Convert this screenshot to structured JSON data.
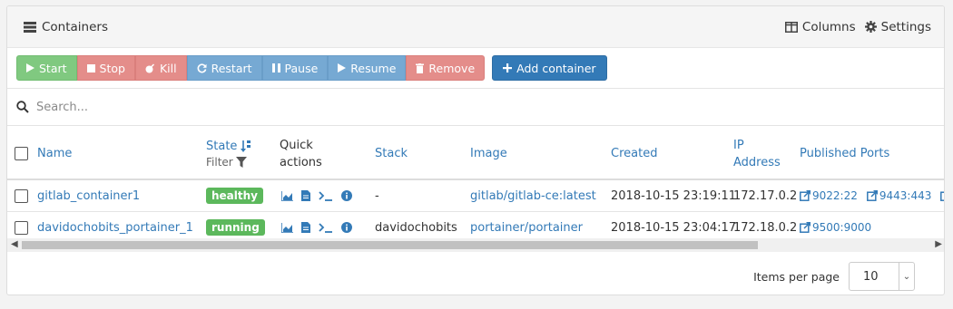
{
  "header": {
    "title": "Containers",
    "columns_label": "Columns",
    "settings_label": "Settings"
  },
  "actions": {
    "start": "Start",
    "stop": "Stop",
    "kill": "Kill",
    "restart": "Restart",
    "pause": "Pause",
    "resume": "Resume",
    "remove": "Remove",
    "add": "Add container"
  },
  "search": {
    "placeholder": "Search..."
  },
  "columns": {
    "name": "Name",
    "state": "State",
    "filter": "Filter",
    "quick_actions_1": "Quick",
    "quick_actions_2": "actions",
    "stack": "Stack",
    "image": "Image",
    "created": "Created",
    "ip_1": "IP",
    "ip_2": "Address",
    "ports": "Published Ports"
  },
  "rows": [
    {
      "name": "gitlab_container1",
      "state": "healthy",
      "stack": "-",
      "image": "gitlab/gitlab-ce:latest",
      "created": "2018-10-15 23:19:11",
      "ip": "172.17.0.2",
      "ports": [
        "9022:22",
        "9443:443"
      ]
    },
    {
      "name": "davidochobits_portainer_1",
      "state": "running",
      "stack": "davidochobits",
      "image": "portainer/portainer",
      "created": "2018-10-15 23:04:17",
      "ip": "172.18.0.2",
      "ports": [
        "9500:9000"
      ]
    }
  ],
  "pagination": {
    "items_per_page_label": "Items per page",
    "items_per_page_value": "10"
  },
  "colors": {
    "primary": "#337ab7",
    "success": "#5cb85c",
    "danger": "#e48d8a"
  }
}
